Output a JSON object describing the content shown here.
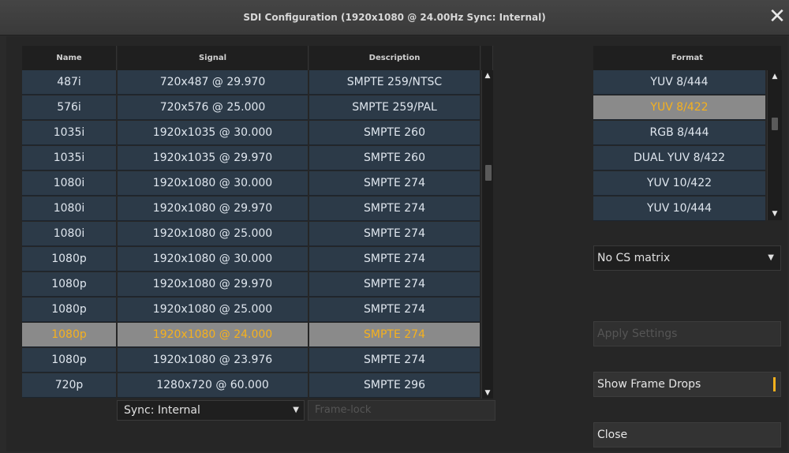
{
  "window": {
    "title": "SDI Configuration (1920x1080 @ 24.00Hz Sync: Internal)",
    "close_glyph": "✕"
  },
  "table": {
    "columns": [
      "Name",
      "Signal",
      "Description"
    ],
    "rows": [
      {
        "name": "487i",
        "signal": "720x487 @ 29.970",
        "description": "SMPTE 259/NTSC"
      },
      {
        "name": "576i",
        "signal": "720x576 @ 25.000",
        "description": "SMPTE 259/PAL"
      },
      {
        "name": "1035i",
        "signal": "1920x1035 @ 30.000",
        "description": "SMPTE 260"
      },
      {
        "name": "1035i",
        "signal": "1920x1035 @ 29.970",
        "description": "SMPTE 260"
      },
      {
        "name": "1080i",
        "signal": "1920x1080 @ 30.000",
        "description": "SMPTE 274"
      },
      {
        "name": "1080i",
        "signal": "1920x1080 @ 29.970",
        "description": "SMPTE 274"
      },
      {
        "name": "1080i",
        "signal": "1920x1080 @ 25.000",
        "description": "SMPTE 274"
      },
      {
        "name": "1080p",
        "signal": "1920x1080 @ 30.000",
        "description": "SMPTE 274"
      },
      {
        "name": "1080p",
        "signal": "1920x1080 @ 29.970",
        "description": "SMPTE 274"
      },
      {
        "name": "1080p",
        "signal": "1920x1080 @ 25.000",
        "description": "SMPTE 274"
      },
      {
        "name": "1080p",
        "signal": "1920x1080 @ 24.000",
        "description": "SMPTE 274",
        "selected": true
      },
      {
        "name": "1080p",
        "signal": "1920x1080 @ 23.976",
        "description": "SMPTE 274"
      },
      {
        "name": "720p",
        "signal": "1280x720 @ 60.000",
        "description": "SMPTE 296"
      }
    ],
    "scroll_up_glyph": "▲",
    "scroll_down_glyph": "▼"
  },
  "sync": {
    "value": "Sync: Internal",
    "dropdown_glyph": "▼"
  },
  "framelock": {
    "placeholder": "Frame-lock"
  },
  "format": {
    "header": "Format",
    "items": [
      "YUV 8/444",
      "YUV 8/422",
      "RGB 8/444",
      "DUAL YUV 8/422",
      "YUV 10/422",
      "YUV 10/444"
    ],
    "selected_index": 1
  },
  "cs_matrix": {
    "value": "No CS matrix",
    "dropdown_glyph": "▼"
  },
  "buttons": {
    "apply": "Apply Settings",
    "show_frame_drops": "Show Frame Drops",
    "close": "Close"
  },
  "colors": {
    "accent": "#f6b11d",
    "row_bg": "#2c3a48",
    "selected_bg": "#8a8a8a"
  }
}
